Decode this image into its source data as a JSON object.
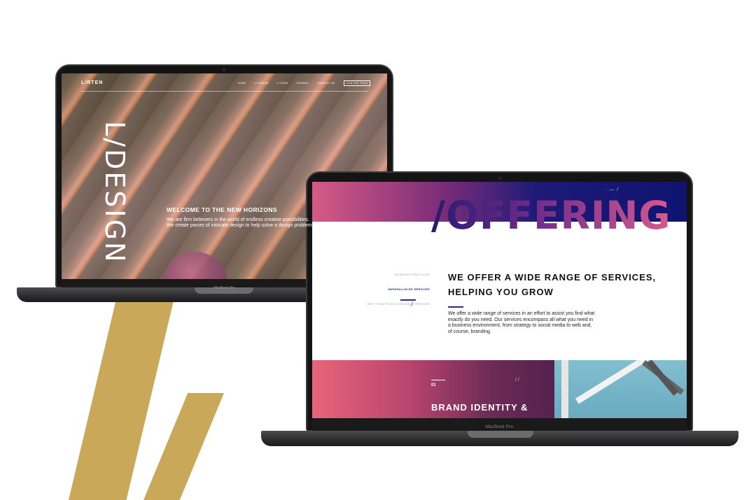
{
  "laptop_left": {
    "brand_label": "MacBook Pro",
    "site": {
      "logo": "L/RTEN",
      "nav": [
        "HOME",
        "L/ DESIGN",
        "L/ CODE",
        "SHOWUS",
        "CONTACT US"
      ],
      "nav_cta": "JOIN THE TEAM",
      "hero_word": "L/DESIGN",
      "welcome_heading": "WELCOME TO THE NEW HORIZONS",
      "welcome_body": "We are firm believers in the world of endless creative possibilities. We create pieces of intricate design to help solve a design problem."
    }
  },
  "laptop_right": {
    "brand_label": "MacBook Pro",
    "site": {
      "banner_title": "/OFFERING",
      "banner_deco": "· — /",
      "side_items": [
        "INTRICATE PRACTICES",
        "UNPARALLELED SERVICES",
        "BEST PRACTICES & RELIABLE PROCESS"
      ],
      "side_mark": "/",
      "heading": "WE OFFER A WIDE RANGE OF SERVICES, HELPING YOU GROW",
      "body": "We offer a wide range of services in an effort to assist you find what exactly do you need. Our services encompass all what you need in a business environment, from strategy to social media to web and, of course, branding.",
      "card_number": "01",
      "card_deco": "/ /",
      "card_title": "BRAND IDENTITY &"
    }
  },
  "colors": {
    "gold_accent": "#c9a85a",
    "banner_gradient_start": "#d65a86",
    "banner_gradient_end": "#0e1470",
    "card_gradient_start": "#e8647a",
    "card_gradient_end": "#55214e"
  }
}
